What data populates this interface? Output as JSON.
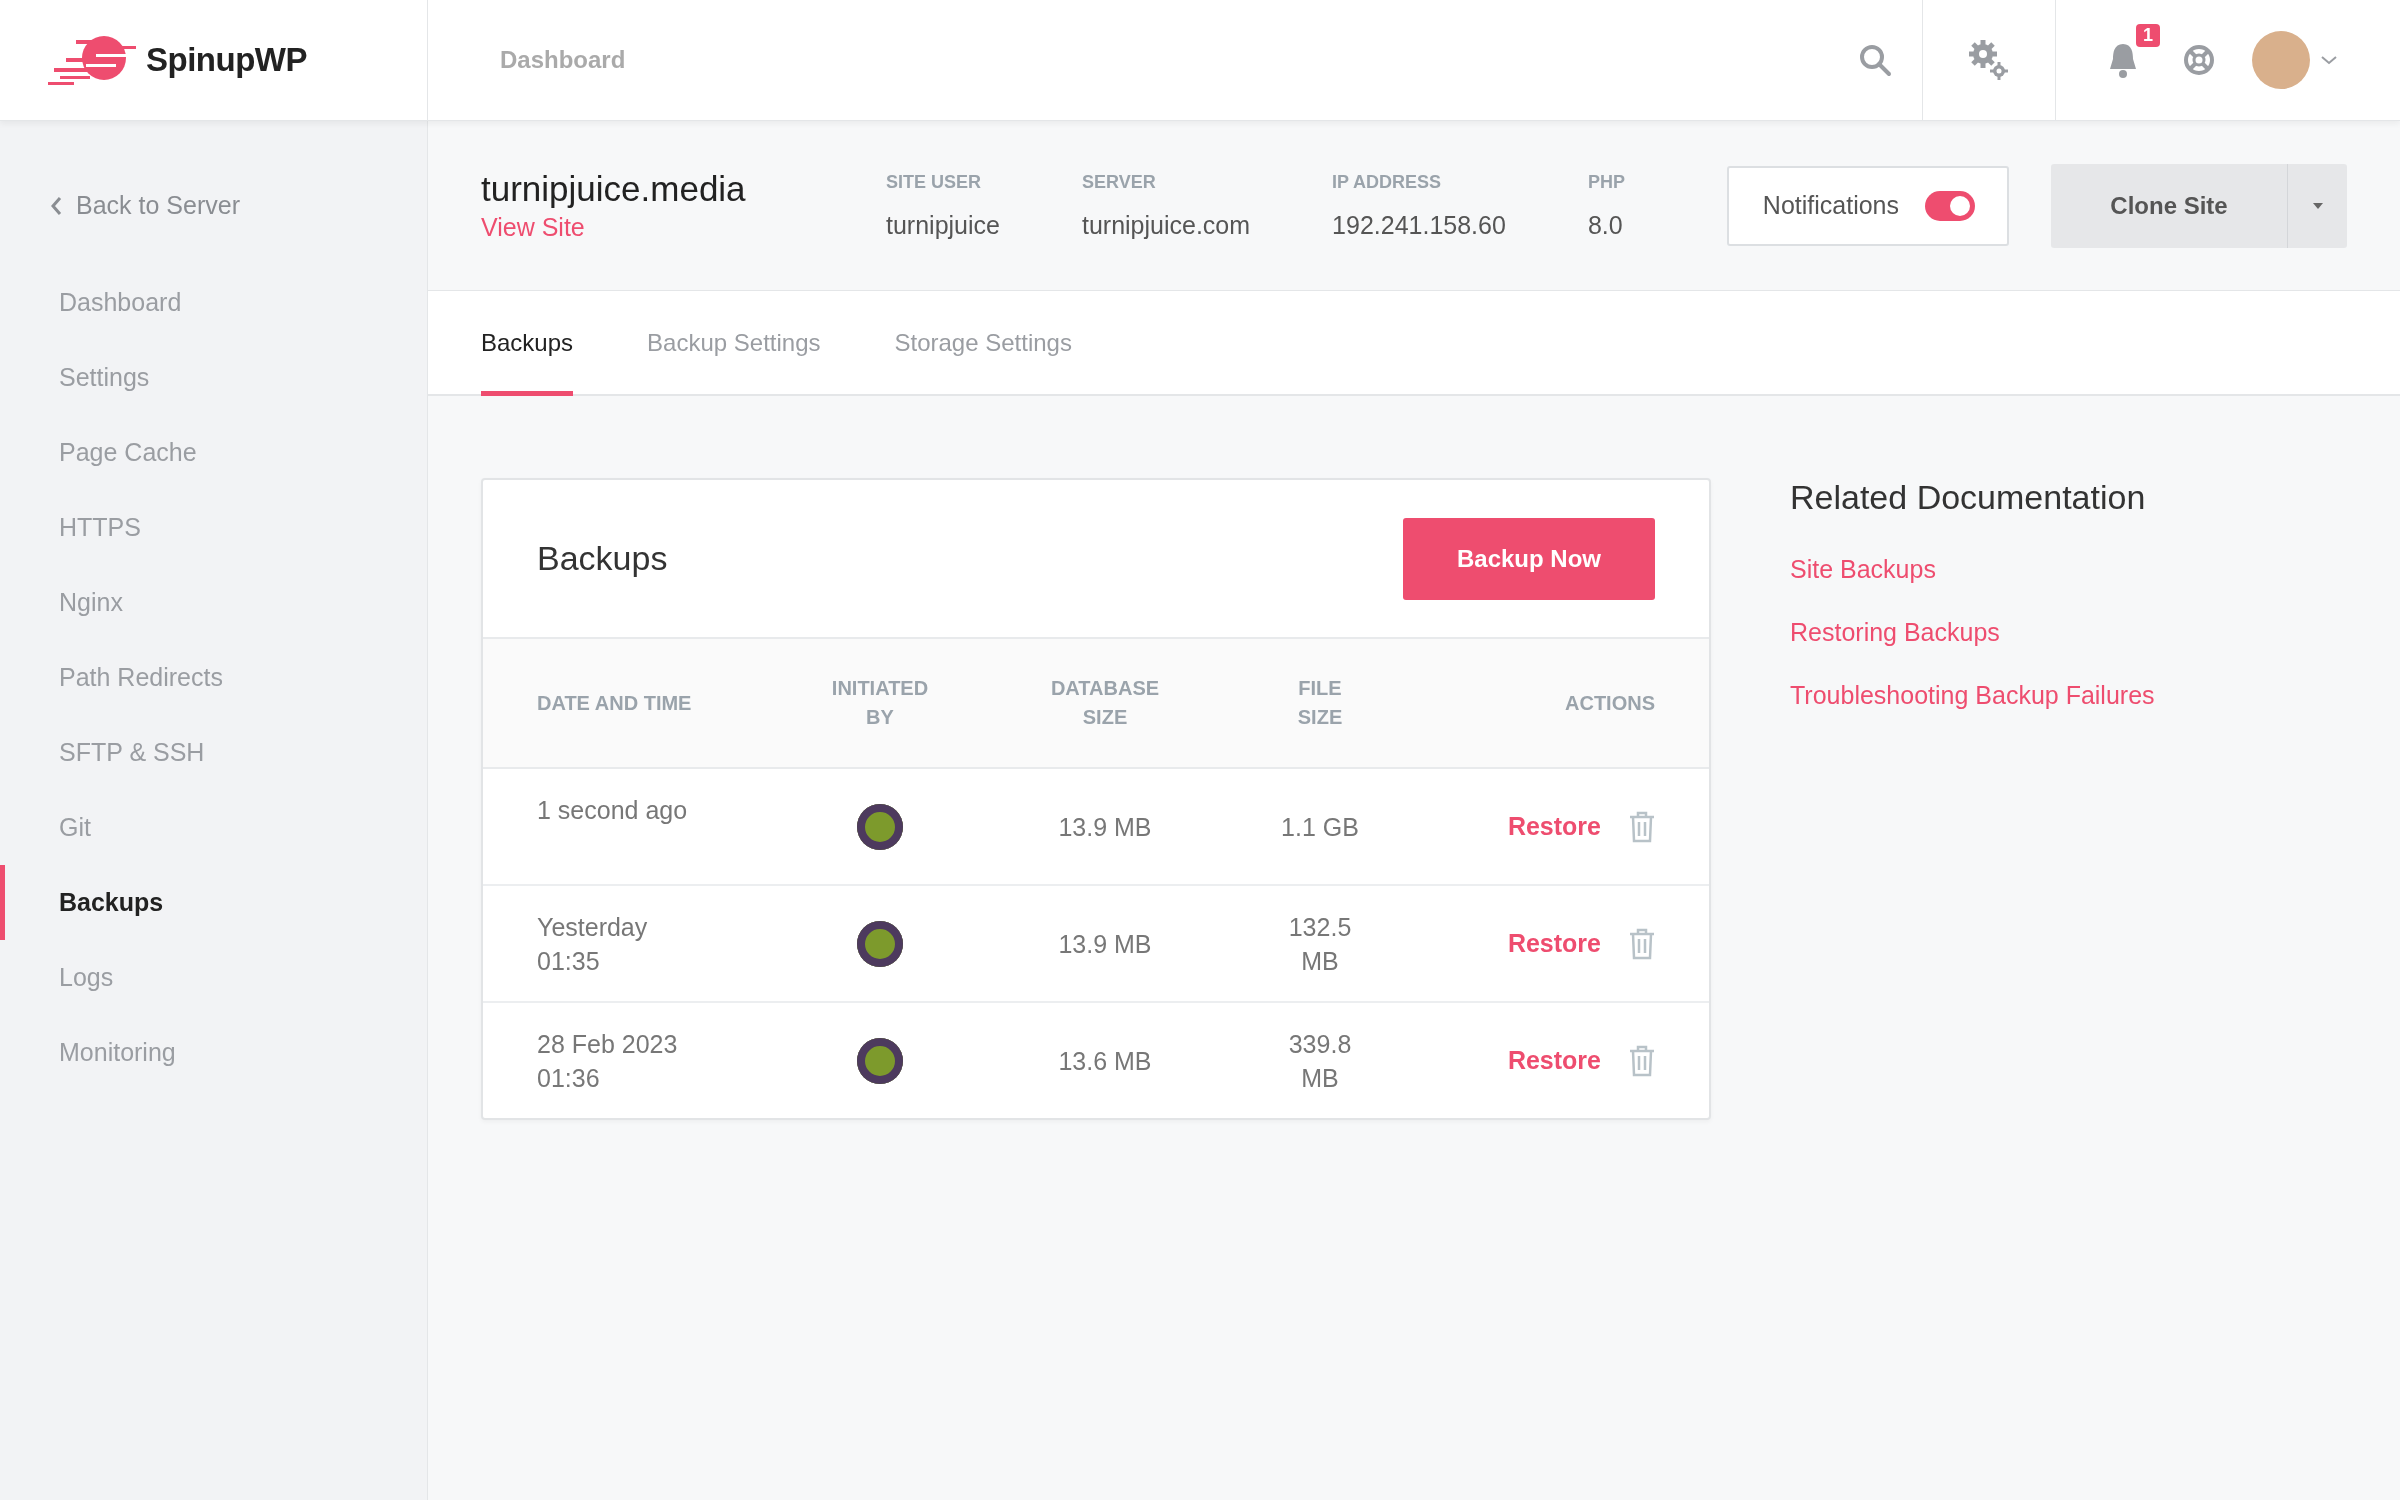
{
  "brand": {
    "name": "SpinupWP"
  },
  "topbar": {
    "title": "Dashboard",
    "notification_count": "1"
  },
  "sidebar": {
    "back": "Back to Server",
    "items": [
      {
        "label": "Dashboard",
        "selected": false
      },
      {
        "label": "Settings",
        "selected": false
      },
      {
        "label": "Page Cache",
        "selected": false
      },
      {
        "label": "HTTPS",
        "selected": false
      },
      {
        "label": "Nginx",
        "selected": false
      },
      {
        "label": "Path Redirects",
        "selected": false
      },
      {
        "label": "SFTP & SSH",
        "selected": false
      },
      {
        "label": "Git",
        "selected": false
      },
      {
        "label": "Backups",
        "selected": true
      },
      {
        "label": "Logs",
        "selected": false
      },
      {
        "label": "Monitoring",
        "selected": false
      }
    ]
  },
  "site": {
    "domain": "turnipjuice.media",
    "view_link": "View Site",
    "facts": [
      {
        "label": "SITE USER",
        "value": "turnipjuice"
      },
      {
        "label": "SERVER",
        "value": "turnipjuice.com"
      },
      {
        "label": "IP ADDRESS",
        "value": "192.241.158.60"
      },
      {
        "label": "PHP",
        "value": "8.0"
      }
    ],
    "notifications": {
      "label": "Notifications",
      "on": true
    },
    "clone_button": "Clone Site"
  },
  "tabs": [
    {
      "label": "Backups",
      "selected": true
    },
    {
      "label": "Backup Settings",
      "selected": false
    },
    {
      "label": "Storage Settings",
      "selected": false
    }
  ],
  "backups": {
    "title": "Backups",
    "button": "Backup Now",
    "columns": [
      "DATE AND TIME",
      "INITIATED BY",
      "DATABASE SIZE",
      "FILE SIZE",
      "ACTIONS"
    ],
    "rows": [
      {
        "date": "1 second ago",
        "database_size": "13.9 MB",
        "file_size": "1.1 GB",
        "action": "Restore"
      },
      {
        "date": "Yesterday 01:35",
        "database_size": "13.9 MB",
        "file_size": "132.5 MB",
        "action": "Restore"
      },
      {
        "date": "28 Feb 2023 01:36",
        "database_size": "13.6 MB",
        "file_size": "339.8 MB",
        "action": "Restore"
      }
    ]
  },
  "docs": {
    "title": "Related Documentation",
    "links": [
      "Site Backups",
      "Restoring Backups",
      "Troubleshooting Backup Failures"
    ]
  }
}
